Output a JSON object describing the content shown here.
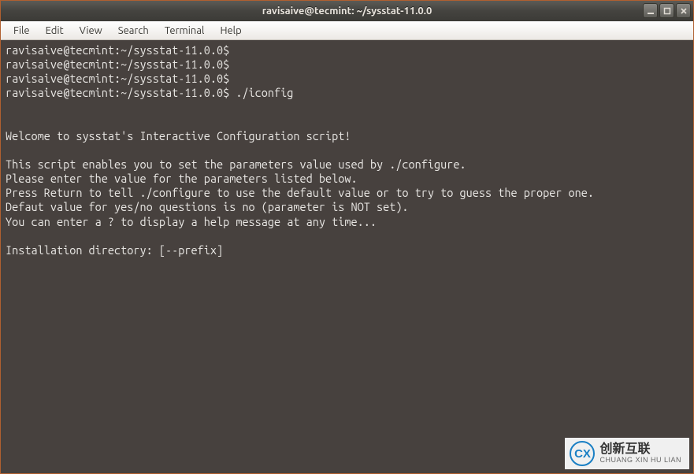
{
  "window": {
    "title": "ravisaive@tecmint: ~/sysstat-11.0.0"
  },
  "menubar": {
    "items": [
      "File",
      "Edit",
      "View",
      "Search",
      "Terminal",
      "Help"
    ]
  },
  "terminal": {
    "lines": [
      "ravisaive@tecmint:~/sysstat-11.0.0$",
      "ravisaive@tecmint:~/sysstat-11.0.0$",
      "ravisaive@tecmint:~/sysstat-11.0.0$",
      "ravisaive@tecmint:~/sysstat-11.0.0$ ./iconfig",
      "",
      "",
      "Welcome to sysstat's Interactive Configuration script!",
      "",
      "This script enables you to set the parameters value used by ./configure.",
      "Please enter the value for the parameters listed below.",
      "Press Return to tell ./configure to use the default value or to try to guess the proper one.",
      "Defaut value for yes/no questions is no (parameter is NOT set).",
      "You can enter a ? to display a help message at any time...",
      "",
      "Installation directory: [--prefix]"
    ]
  },
  "watermark": {
    "initials": "CX",
    "cn": "创新互联",
    "en": "CHUANG XIN HU LIAN"
  }
}
